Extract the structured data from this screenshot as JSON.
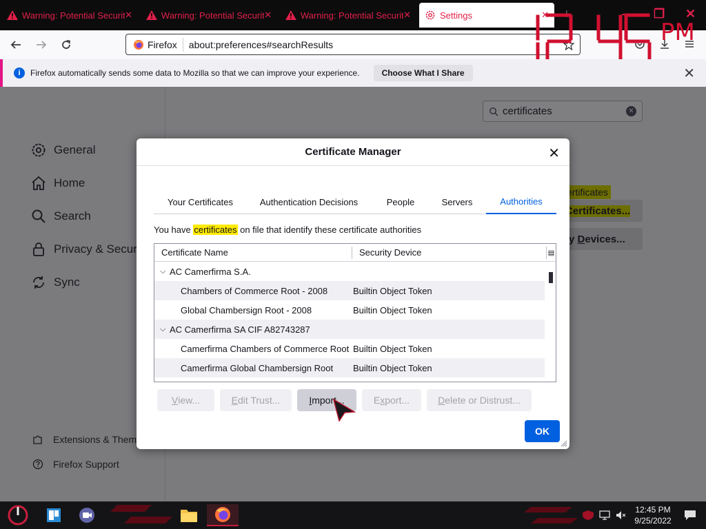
{
  "browser": {
    "tabs": [
      {
        "label": "Warning: Potential Security Risk Ahead",
        "type": "warning"
      },
      {
        "label": "Warning: Potential Security Risk Ahead",
        "type": "warning"
      },
      {
        "label": "Warning: Potential Security Risk Ahead",
        "type": "warning"
      },
      {
        "label": "Settings",
        "type": "settings",
        "active": true
      }
    ],
    "identity_label": "Firefox",
    "url": "about:preferences#searchResults",
    "accent_color": "#e0204a"
  },
  "clock_overlay": {
    "digits": "12 45",
    "suffix": "PM"
  },
  "notification": {
    "message": "Firefox automatically sends some data to Mozilla so that we can improve your experience.",
    "button": "Choose What I Share"
  },
  "preferences": {
    "categories": [
      {
        "label": "General",
        "icon": "gear-icon"
      },
      {
        "label": "Home",
        "icon": "home-icon"
      },
      {
        "label": "Search",
        "icon": "search-icon"
      },
      {
        "label": "Privacy & Security",
        "icon": "lock-icon"
      },
      {
        "label": "Sync",
        "icon": "sync-icon"
      }
    ],
    "footer": [
      {
        "label": "Extensions & Themes",
        "icon": "puzzle-icon"
      },
      {
        "label": "Firefox Support",
        "icon": "help-icon"
      }
    ],
    "search_value": "certificates",
    "bg_tag": "ertificates",
    "bg_view_certs": "Certificates...",
    "bg_security_devices_pre": "ty ",
    "bg_security_devices_ul": "D",
    "bg_security_devices_post": "evices..."
  },
  "dialog": {
    "title": "Certificate Manager",
    "tabs": [
      "Your Certificates",
      "Authentication Decisions",
      "People",
      "Servers",
      "Authorities"
    ],
    "active_tab": "Authorities",
    "description_pre": "You have ",
    "description_highlight": "certificates",
    "description_post": " on file that identify these certificate authorities",
    "columns": [
      "Certificate Name",
      "Security Device"
    ],
    "rows": [
      {
        "name": "AC Camerfirma S.A.",
        "device": "",
        "group": true
      },
      {
        "name": "Chambers of Commerce Root - 2008",
        "device": "Builtin Object Token",
        "group": false
      },
      {
        "name": "Global Chambersign Root - 2008",
        "device": "Builtin Object Token",
        "group": false
      },
      {
        "name": "AC Camerfirma SA CIF A82743287",
        "device": "",
        "group": true
      },
      {
        "name": "Camerfirma Chambers of Commerce Root",
        "device": "Builtin Object Token",
        "group": false
      },
      {
        "name": "Camerfirma Global Chambersign Root",
        "device": "Builtin Object Token",
        "group": false
      }
    ],
    "buttons": [
      {
        "u": "V",
        "rest": "iew...",
        "enabled": false
      },
      {
        "u": "E",
        "rest": "dit Trust...",
        "enabled": false
      },
      {
        "u": "I",
        "rest": "mport...",
        "enabled": true
      },
      {
        "u": "x",
        "pre": "E",
        "rest": "port...",
        "enabled": false
      },
      {
        "u": "D",
        "rest": "elete or Distrust...",
        "enabled": false
      }
    ],
    "ok": "OK"
  },
  "taskbar": {
    "time": "12:45 PM",
    "date": "9/25/2022"
  }
}
